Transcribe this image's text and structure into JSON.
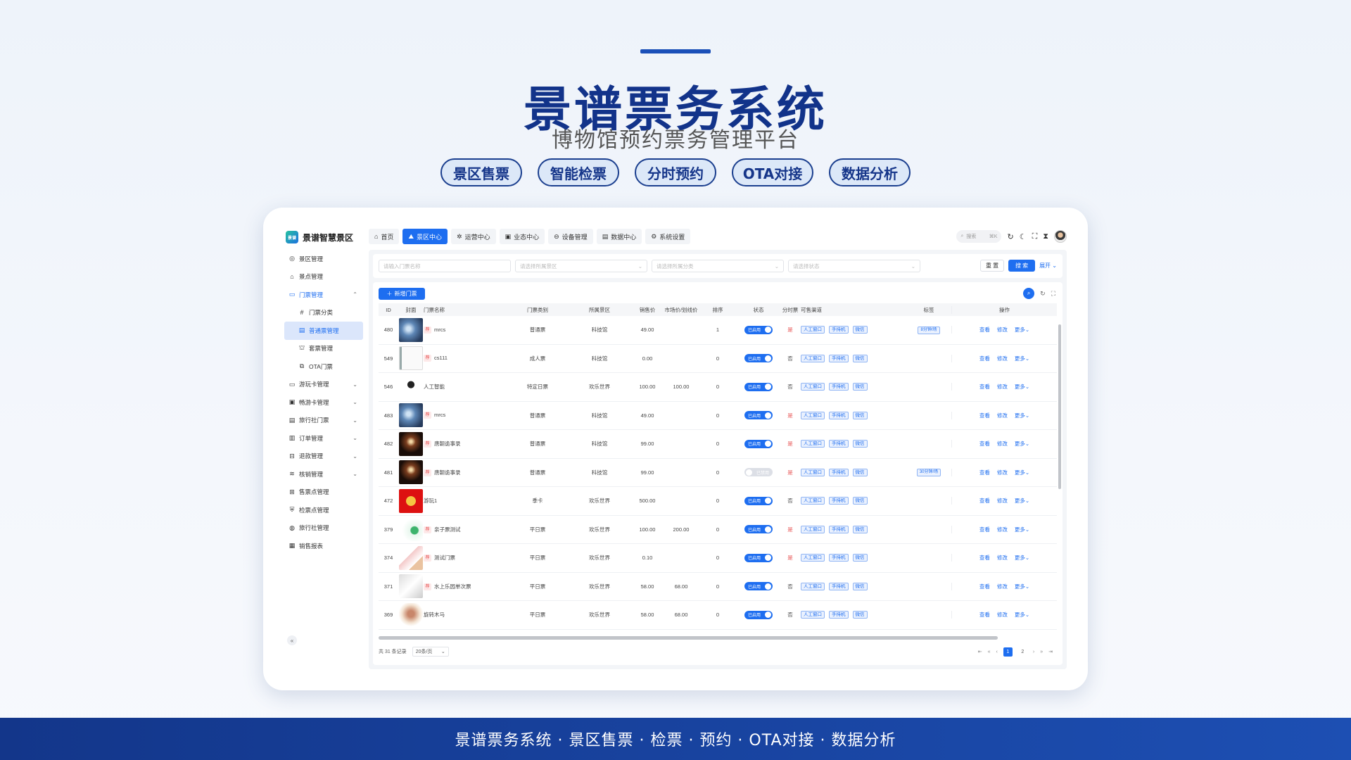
{
  "hero": {
    "title": "景谱票务系统",
    "subtitle": "博物馆预约票务管理平台",
    "features": [
      "景区售票",
      "智能检票",
      "分时预约",
      "OTA对接",
      "数据分析"
    ]
  },
  "footer": {
    "text": "景谱票务系统 · 景区售票 · 检票 · 预约 · OTA对接 · 数据分析"
  },
  "app": {
    "logo_badge": "景谱",
    "logo_text": "景谱智慧景区",
    "nav": [
      {
        "label": "首页",
        "icon": "⌂"
      },
      {
        "label": "景区中心",
        "icon": "⛰"
      },
      {
        "label": "运营中心",
        "icon": "✲"
      },
      {
        "label": "业态中心",
        "icon": "▣"
      },
      {
        "label": "设备管理",
        "icon": "⊖"
      },
      {
        "label": "数据中心",
        "icon": "▤"
      },
      {
        "label": "系统设置",
        "icon": "⚙"
      }
    ],
    "search": {
      "placeholder": "搜索",
      "shortcut": "⌘K"
    },
    "sidebar": [
      {
        "label": "景区管理",
        "icon": "◎"
      },
      {
        "label": "景点管理",
        "icon": "⌂"
      },
      {
        "label": "门票管理",
        "icon": "▭"
      },
      {
        "label": "门票分类",
        "icon": "#"
      },
      {
        "label": "普通票管理",
        "icon": "▤"
      },
      {
        "label": "套票管理",
        "icon": "⛫"
      },
      {
        "label": "OTA门票",
        "icon": "⧉"
      },
      {
        "label": "游玩卡管理",
        "icon": "▭"
      },
      {
        "label": "畅游卡管理",
        "icon": "▣"
      },
      {
        "label": "旅行社门票",
        "icon": "▤"
      },
      {
        "label": "订单管理",
        "icon": "▥"
      },
      {
        "label": "退款管理",
        "icon": "⊟"
      },
      {
        "label": "核销管理",
        "icon": "≋"
      },
      {
        "label": "售票点管理",
        "icon": "⊞"
      },
      {
        "label": "检票点管理",
        "icon": "⛨"
      },
      {
        "label": "旅行社管理",
        "icon": "◍"
      },
      {
        "label": "销售报表",
        "icon": "▦"
      }
    ],
    "filters": {
      "name_placeholder": "请输入门票名称",
      "area_placeholder": "请选择所属景区",
      "category_placeholder": "请选择所属分类",
      "status_placeholder": "请选择状态",
      "reset": "重 置",
      "search": "搜 索",
      "expand": "展开"
    },
    "add_button": "新增门票",
    "columns": [
      "ID",
      "封面",
      "门票名称",
      "门票类别",
      "所属景区",
      "销售价",
      "市场价/划线价",
      "排序",
      "状态",
      "分时票",
      "可售渠道",
      "标签",
      "操作"
    ],
    "rows": [
      {
        "id": "480",
        "thumb": "t-blue",
        "rec": "荐",
        "name": "mrcs",
        "type": "普通票",
        "area": "科技馆",
        "price": "49.00",
        "mkt": "",
        "sort": "1",
        "status": "已启用",
        "on": true,
        "timed": "是",
        "tag": "8分钟/场"
      },
      {
        "id": "549",
        "thumb": "t-doc",
        "rec": "荐",
        "name": "cs111",
        "type": "成人票",
        "area": "科技馆",
        "price": "0.00",
        "mkt": "",
        "sort": "0",
        "status": "已启用",
        "on": true,
        "timed": "否",
        "tag": ""
      },
      {
        "id": "546",
        "thumb": "t-dev",
        "rec": "",
        "name": "人工智能",
        "type": "特定日票",
        "area": "欢乐世界",
        "price": "100.00",
        "mkt": "100.00",
        "sort": "0",
        "status": "已启用",
        "on": true,
        "timed": "否",
        "tag": ""
      },
      {
        "id": "483",
        "thumb": "t-blue",
        "rec": "荐",
        "name": "mrcs",
        "type": "普通票",
        "area": "科技馆",
        "price": "49.00",
        "mkt": "",
        "sort": "0",
        "status": "已启用",
        "on": true,
        "timed": "是",
        "tag": ""
      },
      {
        "id": "482",
        "thumb": "t-dark",
        "rec": "荐",
        "name": "唐朝诡事录",
        "type": "普通票",
        "area": "科技馆",
        "price": "99.00",
        "mkt": "",
        "sort": "0",
        "status": "已启用",
        "on": true,
        "timed": "是",
        "tag": ""
      },
      {
        "id": "481",
        "thumb": "t-dark",
        "rec": "荐",
        "name": "唐朝诡事录",
        "type": "普通票",
        "area": "科技馆",
        "price": "99.00",
        "mkt": "",
        "sort": "0",
        "status": "已禁用",
        "on": false,
        "timed": "是",
        "tag": "30分钟/场"
      },
      {
        "id": "472",
        "thumb": "t-red",
        "rec": "",
        "name": "游玩1",
        "type": "季卡",
        "area": "欢乐世界",
        "price": "500.00",
        "mkt": "",
        "sort": "0",
        "status": "已启用",
        "on": true,
        "timed": "否",
        "tag": ""
      },
      {
        "id": "379",
        "thumb": "t-green",
        "rec": "荐",
        "name": "亲子票测试",
        "type": "平日票",
        "area": "欢乐世界",
        "price": "100.00",
        "mkt": "200.00",
        "sort": "0",
        "status": "已启用",
        "on": true,
        "timed": "是",
        "tag": ""
      },
      {
        "id": "374",
        "thumb": "t-pink",
        "rec": "荐",
        "name": "测试门票",
        "type": "平日票",
        "area": "欢乐世界",
        "price": "0.10",
        "mkt": "",
        "sort": "0",
        "status": "已启用",
        "on": true,
        "timed": "是",
        "tag": ""
      },
      {
        "id": "371",
        "thumb": "t-white",
        "rec": "荐",
        "name": "水上乐园单次票",
        "type": "平日票",
        "area": "欢乐世界",
        "price": "58.00",
        "mkt": "68.00",
        "sort": "0",
        "status": "已启用",
        "on": true,
        "timed": "否",
        "tag": ""
      },
      {
        "id": "369",
        "thumb": "t-horse",
        "rec": "",
        "name": "旋转木马",
        "type": "平日票",
        "area": "欢乐世界",
        "price": "58.00",
        "mkt": "68.00",
        "sort": "0",
        "status": "已启用",
        "on": true,
        "timed": "否",
        "tag": ""
      }
    ],
    "channels": [
      "人工窗口",
      "手持机",
      "微信"
    ],
    "ops": {
      "view": "查看",
      "edit": "修改",
      "more": "更多"
    },
    "pager": {
      "total": "共 31 条记录",
      "size": "20条/页",
      "pages": [
        "1",
        "2"
      ]
    }
  },
  "colors": {
    "accent": "#1e6ef0",
    "brand_dark": "#12338a",
    "danger": "#e64a4a"
  }
}
